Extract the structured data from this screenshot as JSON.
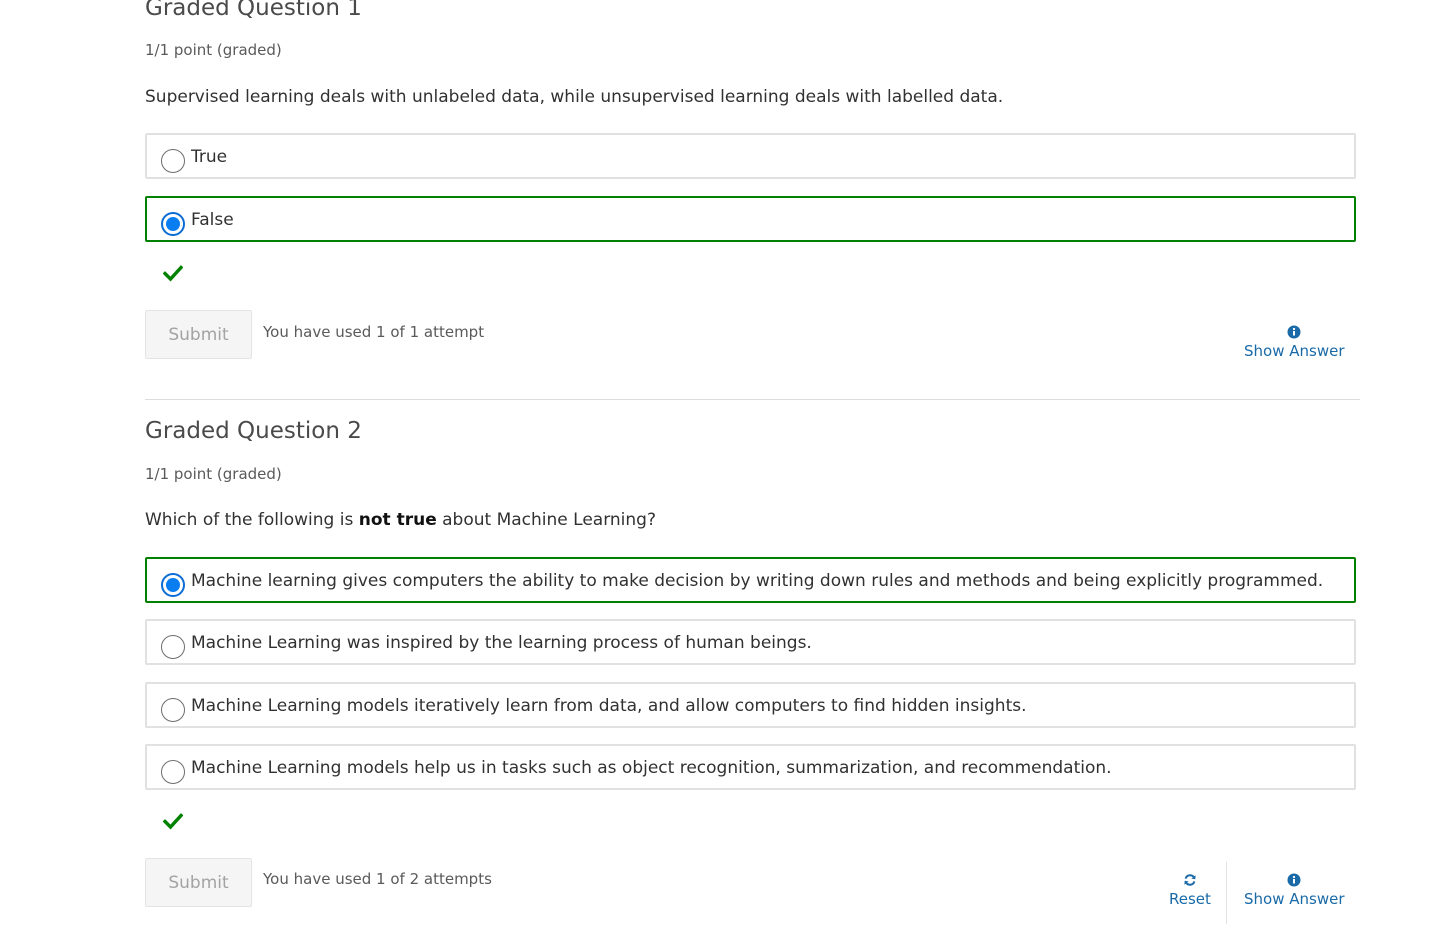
{
  "questions": [
    {
      "title": "Graded Question 1",
      "points": "1/1 point (graded)",
      "prompt": "Supervised learning deals with unlabeled data, while unsupervised learning deals with labelled data.",
      "choices": [
        {
          "label": "True",
          "selected": false,
          "correct": false
        },
        {
          "label": "False",
          "selected": true,
          "correct": true
        }
      ],
      "submit_label": "Submit",
      "attempts": "You have used 1 of 1 attempt",
      "show_answer_label": "Show Answer"
    },
    {
      "title": "Graded Question 2",
      "points": "1/1 point (graded)",
      "prompt_before": "Which of the following is ",
      "prompt_bold": "not true",
      "prompt_after": " about Machine Learning?",
      "choices": [
        {
          "label": "Machine learning gives computers the ability to make decision by writing down rules and methods and being explicitly programmed.",
          "selected": true,
          "correct": true
        },
        {
          "label": "Machine Learning was inspired by the learning process of human beings.",
          "selected": false,
          "correct": false
        },
        {
          "label": "Machine Learning models iteratively learn from data, and allow computers to find hidden insights.",
          "selected": false,
          "correct": false
        },
        {
          "label": "Machine Learning models help us in tasks such as object recognition, summarization, and recommendation.",
          "selected": false,
          "correct": false
        }
      ],
      "submit_label": "Submit",
      "attempts": "You have used 1 of 2 attempts",
      "reset_label": "Reset",
      "show_answer_label": "Show Answer"
    }
  ],
  "colors": {
    "correct_border": "#008100",
    "selected_radio": "#0a7df1",
    "link": "#1a6aa8",
    "check": "#008100"
  },
  "icons": {
    "correct": "checkmark-icon",
    "show_answer": "info-circle-icon",
    "reset": "refresh-icon"
  }
}
